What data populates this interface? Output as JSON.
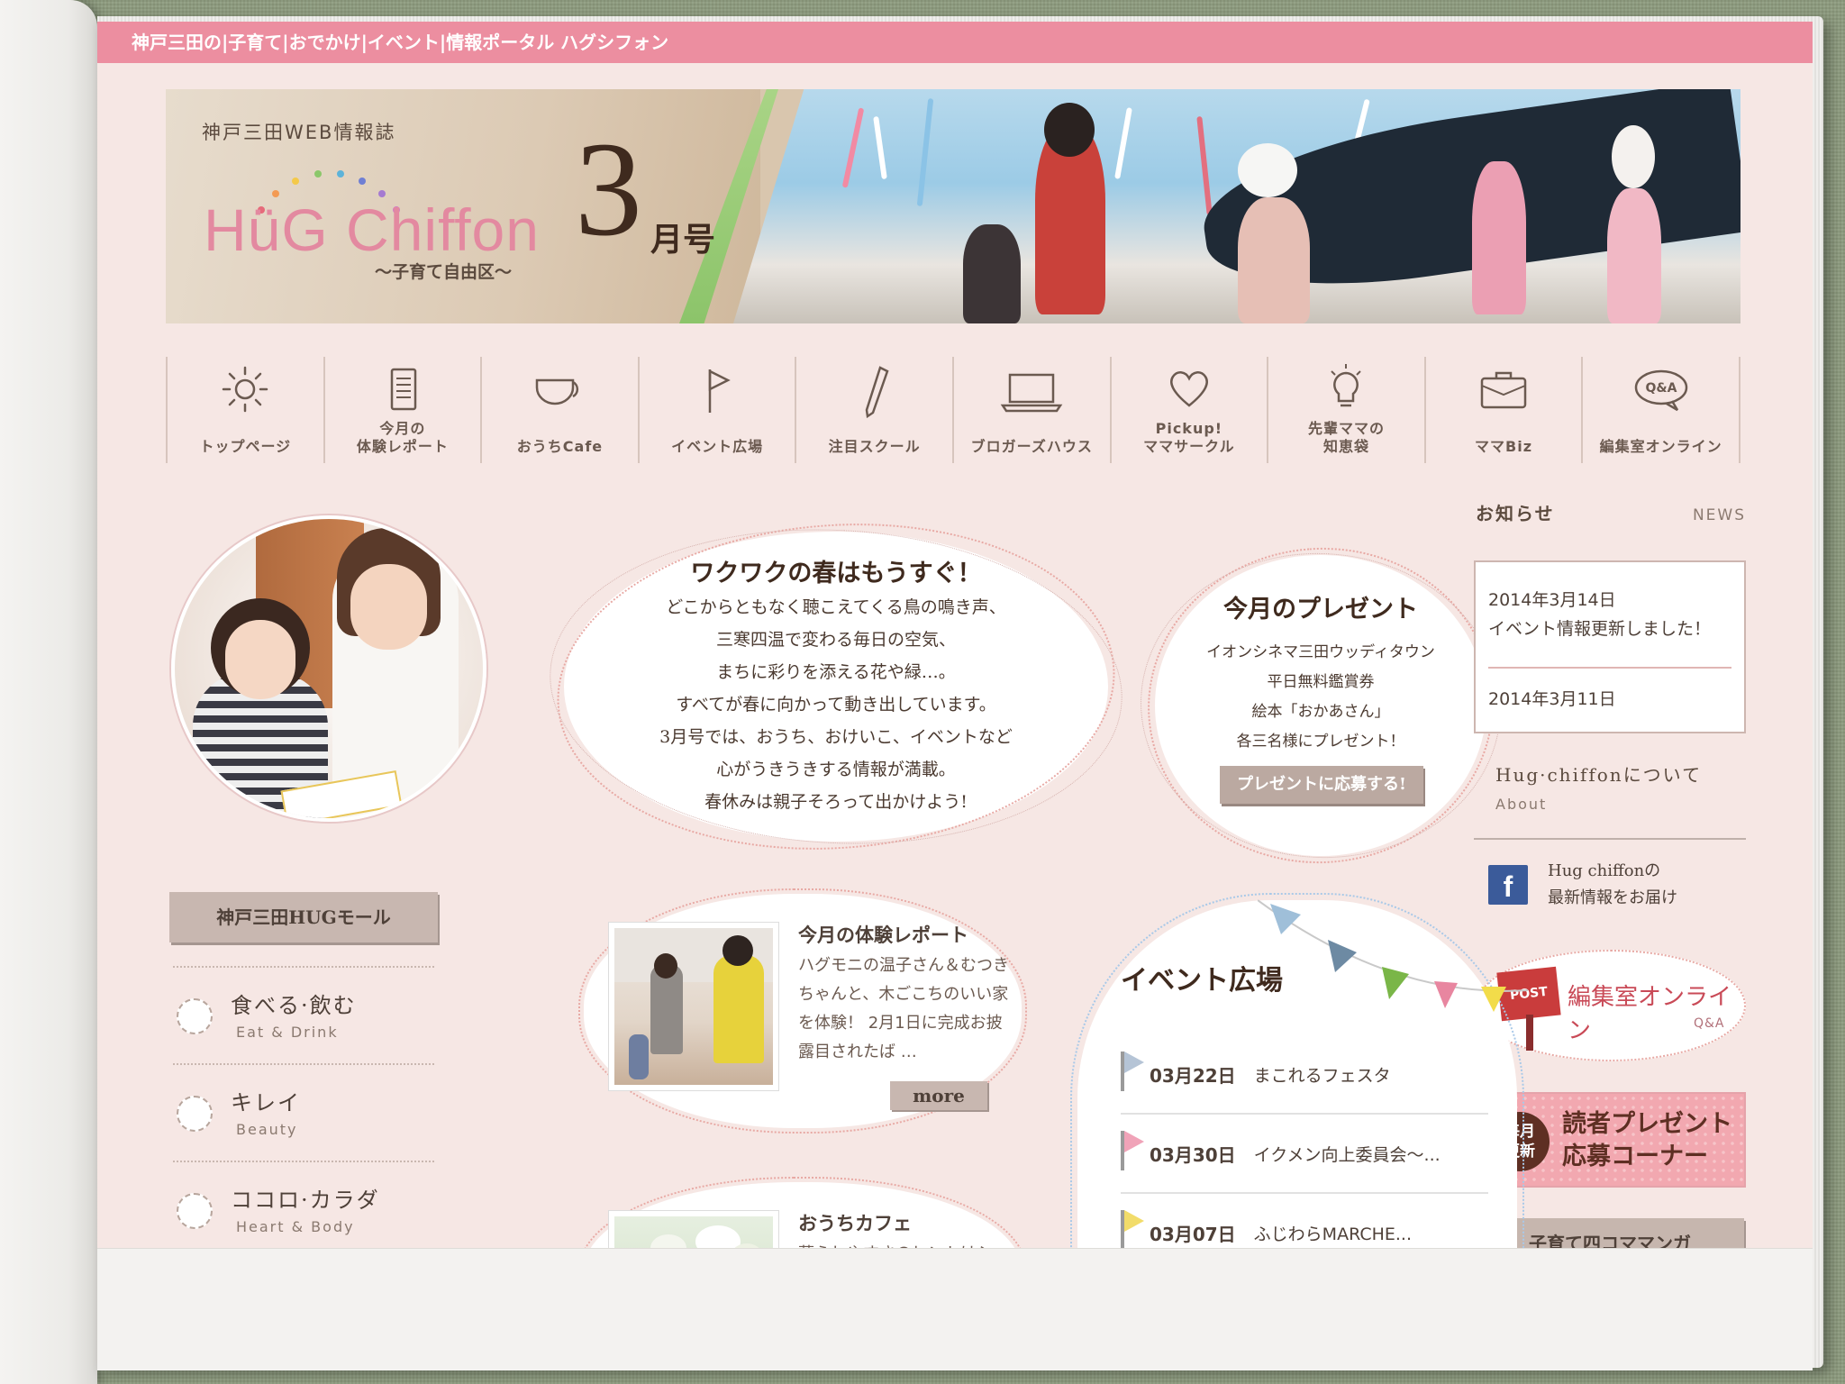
{
  "topbar": {
    "title": "神戸三田の|子育て|おでかけ|イベント|情報ポータル ハグシフォン"
  },
  "banner": {
    "subtitle": "神戸三田WEB情報誌",
    "logo": "HüG Chiffon",
    "tagline": "〜子育て自由区〜",
    "issue_number": "3",
    "issue_suffix": "月号",
    "colors": {
      "logo": "#e389a0",
      "issue": "#3f2a1e",
      "stripe": "#8cc46a"
    }
  },
  "nav": {
    "items": [
      {
        "label": "トップページ",
        "icon": "sun-icon"
      },
      {
        "label": "今月の\n体験レポート",
        "icon": "document-icon"
      },
      {
        "label": "おうちCafe",
        "icon": "cup-icon"
      },
      {
        "label": "イベント広場",
        "icon": "flag-icon"
      },
      {
        "label": "注目スクール",
        "icon": "pencil-icon"
      },
      {
        "label": "ブロガーズハウス",
        "icon": "laptop-icon"
      },
      {
        "label": "Pickup!\nママサークル",
        "icon": "heart-icon"
      },
      {
        "label": "先輩ママの\n知恵袋",
        "icon": "lightbulb-icon"
      },
      {
        "label": "ママBiz",
        "icon": "briefcase-icon"
      },
      {
        "label": "編集室オンライン",
        "icon": "qa-bubble-icon"
      }
    ]
  },
  "hero": {
    "title": "ワクワクの春はもうすぐ！",
    "body": "どこからともなく聴こえてくる鳥の鳴き声、\n三寒四温で変わる毎日の空気、\nまちに彩りを添える花や緑…。\nすべてが春に向かって動き出しています。\n3月号では、おうち、おけいこ、イベントなど\n心がうきうきする情報が満載。\n春休みは親子そろって出かけよう!"
  },
  "present": {
    "title": "今月のプレゼント",
    "body": "イオンシネマ三田ウッディタウン\n平日無料鑑賞券\n絵本「おかあさん」\n各三名様にプレゼント！",
    "button": "プレゼントに応募する!"
  },
  "news": {
    "title": "お知らせ",
    "subtitle": "NEWS",
    "entries": [
      {
        "date": "2014年3月14日",
        "text": "イベント情報更新しました！"
      },
      {
        "date": "2014年3月11日",
        "text": ""
      }
    ]
  },
  "about": {
    "title": "Hug·chiffonについて",
    "subtitle": "About"
  },
  "facebook": {
    "icon_letter": "f",
    "text": "Hug chiffonの\n最新情報をお届け"
  },
  "online": {
    "post_label": "POST",
    "title": "編集室オンライン",
    "subtitle": "Q&A"
  },
  "reader_present": {
    "badge": "毎月\n更新",
    "text": "読者プレゼント\n応募コーナー"
  },
  "manga": {
    "label": "子育て四コママンガ"
  },
  "mall": {
    "title": "神戸三田HUGモール",
    "items": [
      {
        "jp": "食べる·飲む",
        "en": "Eat & Drink"
      },
      {
        "jp": "キレイ",
        "en": "Beauty"
      },
      {
        "jp": "ココロ·カラダ",
        "en": "Heart & Body"
      }
    ]
  },
  "report": {
    "title": "今月の体験レポート",
    "body": "ハグモニの温子さん＆むつきちゃんと、木ごこちのいい家を体験！ 2月1日に完成お披露目されたば …",
    "more": "more"
  },
  "cafe": {
    "title": "おうちカフェ",
    "body": "暮らしやすさのヒントはシ"
  },
  "events": {
    "title": "イベント広場",
    "items": [
      {
        "date": "03月22日",
        "name": "まこれるフェスタ",
        "flag_color": "#b5c4d6"
      },
      {
        "date": "03月30日",
        "name": "イクメン向上委員会〜...",
        "flag_color": "#f0a3b8"
      },
      {
        "date": "03月07日",
        "name": "ふじわらMARCHE...",
        "flag_color": "#f2dc6a"
      }
    ],
    "bunting_colors": [
      "#9fbfd9",
      "#6d8aa3",
      "#7ab648",
      "#e886a0",
      "#f2dc4a"
    ]
  }
}
